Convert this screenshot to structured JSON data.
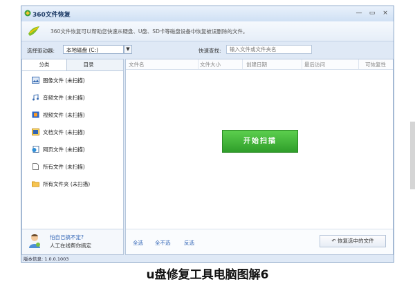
{
  "window": {
    "title": "360文件恢复",
    "controls": [
      "—",
      "▭",
      "×"
    ]
  },
  "banner": {
    "text": "360文件恢复可以帮助您快速从硬盘、U盘、SD卡等磁盘设备中恢复被误删除的文件。"
  },
  "toolbar": {
    "drive_label": "选择驱动器:",
    "drive_value": "本地磁盘 (C:)",
    "search_label": "快速查找:",
    "search_placeholder": "输入文件或文件夹名"
  },
  "sidebar": {
    "tabs": [
      "分类",
      "目录"
    ],
    "categories": [
      {
        "label": "图像文件 (未扫描)",
        "icon": "image-icon"
      },
      {
        "label": "音频文件 (未扫描)",
        "icon": "music-icon"
      },
      {
        "label": "视频文件 (未扫描)",
        "icon": "video-icon"
      },
      {
        "label": "文档文件 (未扫描)",
        "icon": "document-icon"
      },
      {
        "label": "网页文件 (未扫描)",
        "icon": "webpage-icon"
      },
      {
        "label": "所有文件 (未扫描)",
        "icon": "file-icon"
      },
      {
        "label": "所有文件夹 (未扫描)",
        "icon": "folder-icon"
      }
    ],
    "help_line1": "怕自己搞不定?",
    "help_line2": "人工在线帮你搞定"
  },
  "table": {
    "columns": [
      "文件名",
      "文件大小",
      "创建日期",
      "最后访问",
      "可恢复性"
    ]
  },
  "scan_button": "开始扫描",
  "bottom": {
    "select_all": "全选",
    "select_none": "全不选",
    "invert": "反选",
    "restore_label": "恢复选中的文件"
  },
  "status": "版本信息: 1.0.0.1003",
  "caption": "u盘修复工具电脑图解6"
}
